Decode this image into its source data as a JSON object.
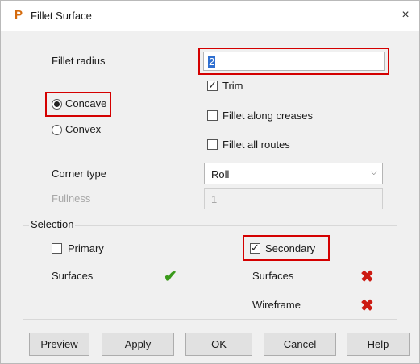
{
  "window": {
    "title": "Fillet Surface",
    "app_icon": "P",
    "close_glyph": "×"
  },
  "form": {
    "fillet_radius_label": "Fillet radius",
    "fillet_radius_value": "2",
    "trim_label": "Trim",
    "trim_checked": true,
    "fillet_along_creases_label": "Fillet along creases",
    "fillet_along_creases_checked": false,
    "fillet_all_routes_label": "Fillet all routes",
    "fillet_all_routes_checked": false,
    "concave_label": "Concave",
    "concave_selected": true,
    "convex_label": "Convex",
    "convex_selected": false,
    "corner_type_label": "Corner type",
    "corner_type_value": "Roll",
    "fullness_label": "Fullness",
    "fullness_value": "1"
  },
  "selection": {
    "group_label": "Selection",
    "primary_label": "Primary",
    "primary_checked": false,
    "secondary_label": "Secondary",
    "secondary_checked": true,
    "left_surfaces_label": "Surfaces",
    "left_surfaces_status": "check-icon",
    "right_surfaces_label": "Surfaces",
    "right_surfaces_status": "cross-icon",
    "wireframe_label": "Wireframe",
    "wireframe_status": "cross-icon"
  },
  "buttons": {
    "preview": "Preview",
    "apply": "Apply",
    "ok": "OK",
    "cancel": "Cancel",
    "help": "Help"
  },
  "colors": {
    "highlight_frame": "#d40000",
    "ok_icon": "#3a9a1a",
    "error_icon": "#cc1a12",
    "app_icon": "#d46a0c"
  }
}
